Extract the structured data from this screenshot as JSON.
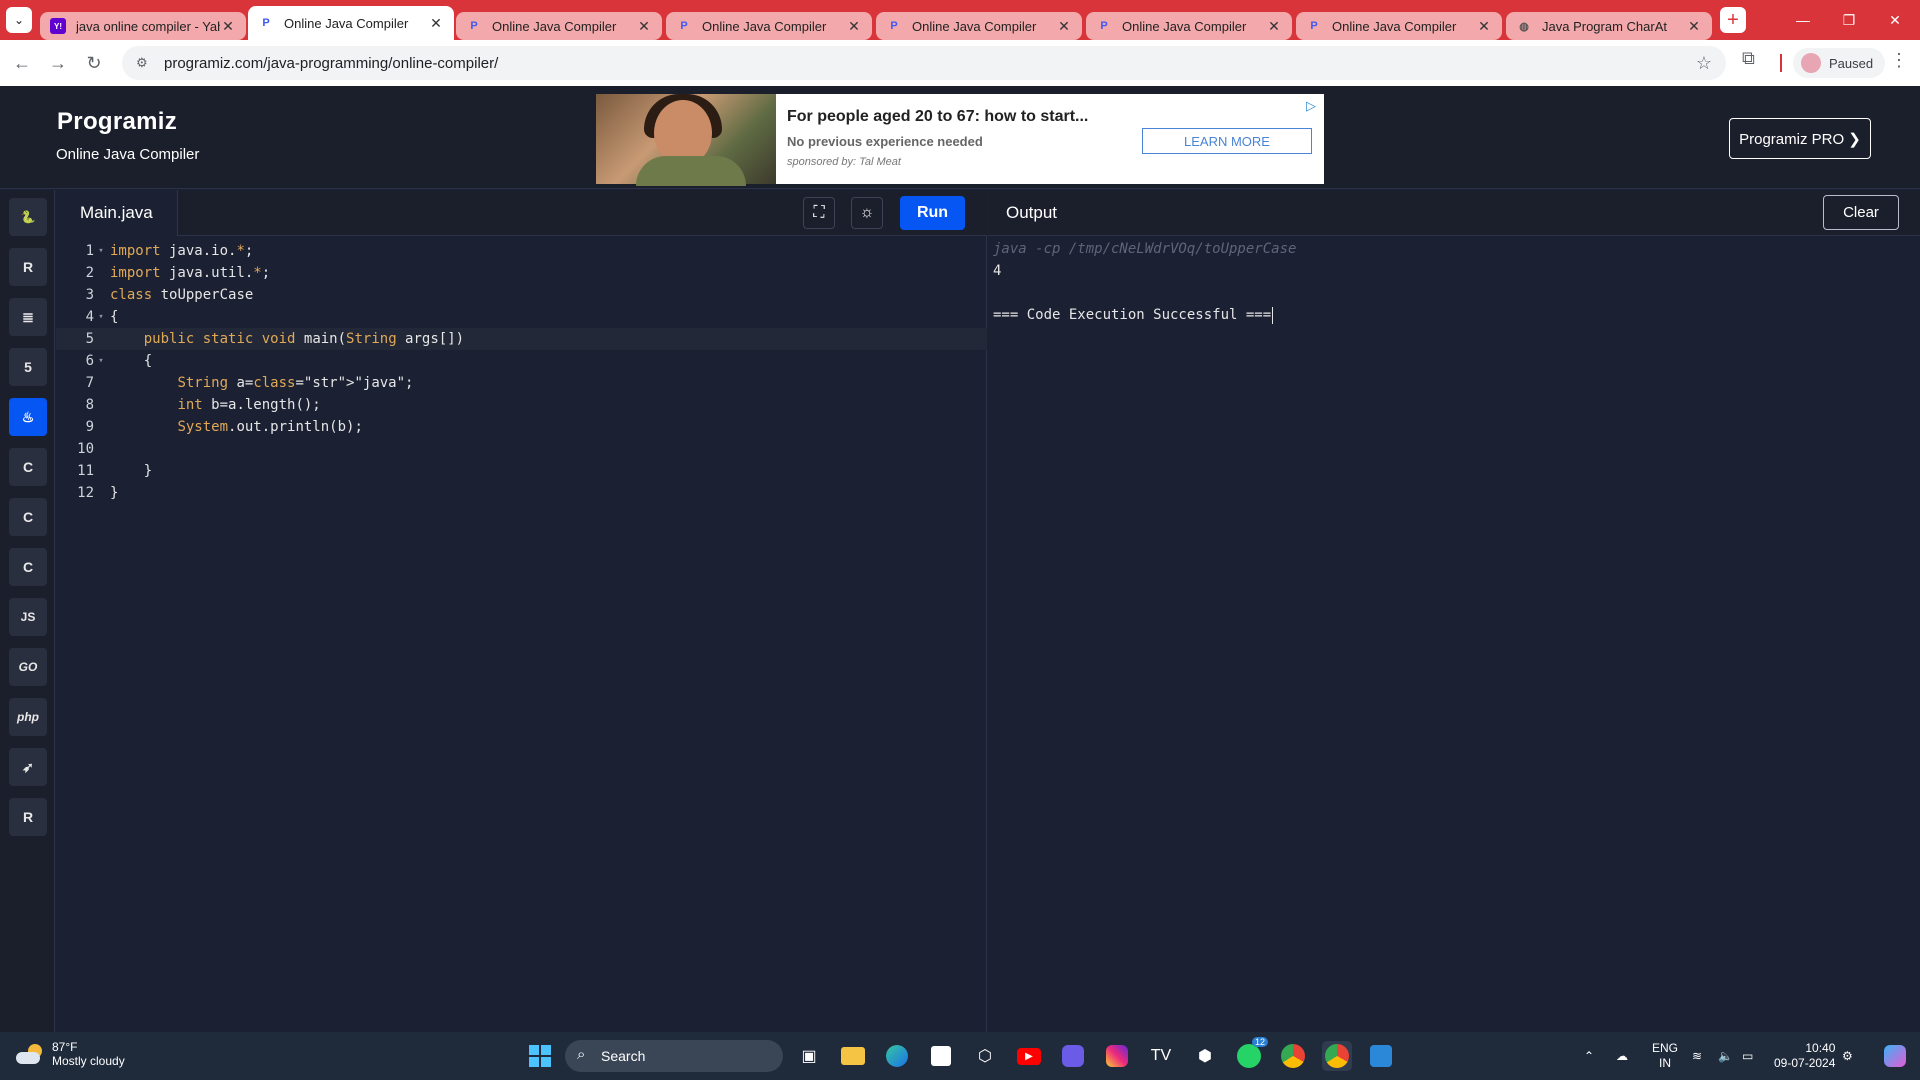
{
  "browser": {
    "tabs": [
      {
        "title": "java online compiler - Yah",
        "favicon": "yahoo-icon",
        "favicon_color": "#6001d2",
        "active": false
      },
      {
        "title": "Online Java Compiler",
        "favicon": "programiz-icon",
        "favicon_color": "#3d5af1",
        "active": true
      },
      {
        "title": "Online Java Compiler",
        "favicon": "programiz-icon",
        "favicon_color": "#3d5af1",
        "active": false
      },
      {
        "title": "Online Java Compiler",
        "favicon": "programiz-icon",
        "favicon_color": "#3d5af1",
        "active": false
      },
      {
        "title": "Online Java Compiler",
        "favicon": "programiz-icon",
        "favicon_color": "#3d5af1",
        "active": false
      },
      {
        "title": "Online Java Compiler",
        "favicon": "programiz-icon",
        "favicon_color": "#3d5af1",
        "active": false
      },
      {
        "title": "Online Java Compiler",
        "favicon": "programiz-icon",
        "favicon_color": "#3d5af1",
        "active": false
      },
      {
        "title": "Java Program CharAt",
        "favicon": "globe-icon",
        "favicon_color": "#555555",
        "active": false
      }
    ],
    "url": "programiz.com/java-programming/online-compiler/",
    "profile_status": "Paused",
    "tab_strip_color": "#d93439"
  },
  "site": {
    "logo": "Programiz",
    "subtitle": "Online Java Compiler",
    "pro_button": "Programiz PRO ❯",
    "ad": {
      "title": "For people aged 20 to 67: how to start...",
      "line": "No previous experience needed",
      "sponsor": "sponsored by: Tal Meat",
      "cta": "LEARN MORE"
    }
  },
  "sidebar": {
    "languages": [
      {
        "name": "python-icon",
        "glyph": "🐍",
        "active": false
      },
      {
        "name": "r-icon",
        "glyph": "R",
        "active": false
      },
      {
        "name": "sql-icon",
        "glyph": "≣",
        "active": false
      },
      {
        "name": "html-icon",
        "glyph": "5",
        "active": false
      },
      {
        "name": "java-icon",
        "glyph": "♨",
        "active": true
      },
      {
        "name": "c-icon",
        "glyph": "C",
        "active": false
      },
      {
        "name": "cpp-icon",
        "glyph": "C",
        "active": false
      },
      {
        "name": "csharp-icon",
        "glyph": "C",
        "active": false
      },
      {
        "name": "javascript-icon",
        "glyph": "JS",
        "active": false
      },
      {
        "name": "go-icon",
        "glyph": "GO",
        "active": false
      },
      {
        "name": "php-icon",
        "glyph": "php",
        "active": false
      },
      {
        "name": "swift-icon",
        "glyph": "➶",
        "active": false
      },
      {
        "name": "rust-icon",
        "glyph": "R",
        "active": false
      }
    ],
    "accent": "#0556f3"
  },
  "editor": {
    "filename": "Main.java",
    "run_label": "Run",
    "lines": [
      {
        "n": "1",
        "fold": true,
        "code": "import java.io.*;"
      },
      {
        "n": "2",
        "fold": false,
        "code": "import java.util.*;"
      },
      {
        "n": "3",
        "fold": false,
        "code": "class toUpperCase"
      },
      {
        "n": "4",
        "fold": true,
        "code": "{"
      },
      {
        "n": "5",
        "fold": false,
        "code": "    public static void main(String args[])"
      },
      {
        "n": "6",
        "fold": true,
        "code": "    {"
      },
      {
        "n": "7",
        "fold": false,
        "code": "        String a=\"java\";"
      },
      {
        "n": "8",
        "fold": false,
        "code": "        int b=a.length();"
      },
      {
        "n": "9",
        "fold": false,
        "code": "        System.out.println(b);"
      },
      {
        "n": "10",
        "fold": false,
        "code": ""
      },
      {
        "n": "11",
        "fold": false,
        "code": "    }"
      },
      {
        "n": "12",
        "fold": false,
        "code": "}"
      }
    ]
  },
  "output": {
    "title": "Output",
    "clear_label": "Clear",
    "command": "java -cp /tmp/cNeLWdrVOq/toUpperCase",
    "result": "4",
    "status": "=== Code Execution Successful ==="
  },
  "taskbar": {
    "temperature": "87°F",
    "condition": "Mostly cloudy",
    "search": "Search",
    "lang_top": "ENG",
    "lang_bottom": "IN",
    "time": "10:40",
    "date": "09-07-2024",
    "whatsapp_badge": "12"
  }
}
